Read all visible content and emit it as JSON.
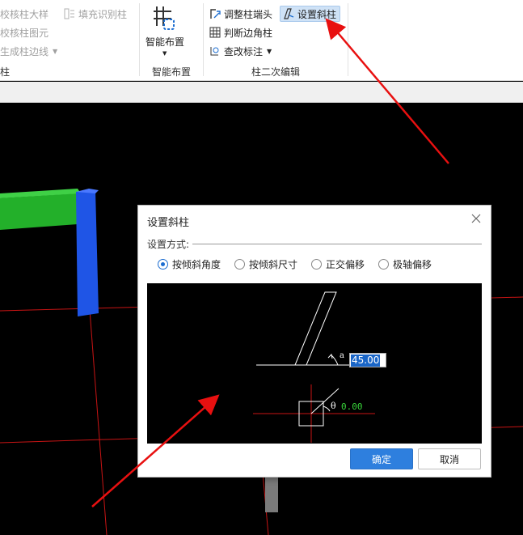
{
  "ribbon": {
    "group1": {
      "items": [
        {
          "label": "校核柱大样"
        },
        {
          "label": "校核柱图元"
        },
        {
          "label": "生成柱边线"
        }
      ],
      "fill_label": "填充识别柱",
      "group_label": "柱"
    },
    "group2": {
      "big_button_label": "智能布置",
      "group_label": "智能布置"
    },
    "group3": {
      "items": [
        {
          "label": "调整柱端头"
        },
        {
          "label": "判断边角柱"
        },
        {
          "label": "查改标注"
        }
      ],
      "set_slanted_label": "设置斜柱",
      "group_label": "柱二次编辑"
    }
  },
  "dialog": {
    "title": "设置斜柱",
    "section_label": "设置方式:",
    "options": [
      {
        "label": "按倾斜角度",
        "selected": true
      },
      {
        "label": "按倾斜尺寸",
        "selected": false
      },
      {
        "label": "正交偏移",
        "selected": false
      },
      {
        "label": "极轴偏移",
        "selected": false
      }
    ],
    "angle_value": "45.00",
    "alpha_symbol": "a",
    "theta_symbol": "θ",
    "theta_value": "0.00",
    "ok_label": "确定",
    "cancel_label": "取消"
  },
  "colors": {
    "accent": "#2e7fde",
    "arrow": "#e81010",
    "column_blue": "#1f55e6",
    "beam_green": "#23b02a",
    "axis_red": "#c81414",
    "theta_green": "#38d23a"
  }
}
